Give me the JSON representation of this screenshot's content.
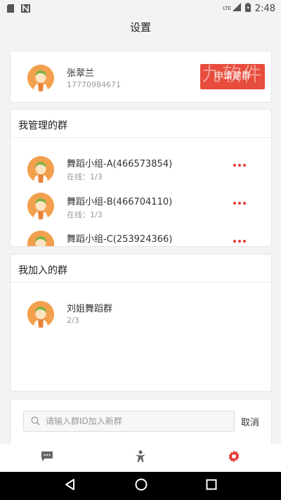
{
  "status_bar": {
    "time": "2:48",
    "network": "LTE"
  },
  "header": {
    "title": "设置"
  },
  "profile": {
    "name": "张翠兰",
    "phone": "17770984671",
    "apply_button_label": "申请建群",
    "watermark_text": "九软件"
  },
  "managed_groups": {
    "title": "我管理的群",
    "groups": [
      {
        "name": "舞蹈小组-A(466573854)",
        "status": "在线：1/3"
      },
      {
        "name": "舞蹈小组-B(466704110)",
        "status": "在线：1/3"
      },
      {
        "name": "舞蹈小组-C(253924366)",
        "status": ""
      }
    ]
  },
  "joined_groups": {
    "title": "我加入的群",
    "groups": [
      {
        "name": "刘姐舞蹈群",
        "status": "2/3"
      }
    ]
  },
  "search": {
    "placeholder": "请输入群ID加入新群",
    "cancel_label": "取消"
  },
  "tab_bar": {
    "active_color": "#e53935",
    "inactive_color": "#666666",
    "tabs": [
      {
        "icon": "message-icon",
        "active": false
      },
      {
        "icon": "person-icon",
        "active": false
      },
      {
        "icon": "gear-icon",
        "active": true
      }
    ]
  },
  "colors": {
    "accent": "#e74c3c",
    "avatar_bg": "#f3a04e"
  }
}
